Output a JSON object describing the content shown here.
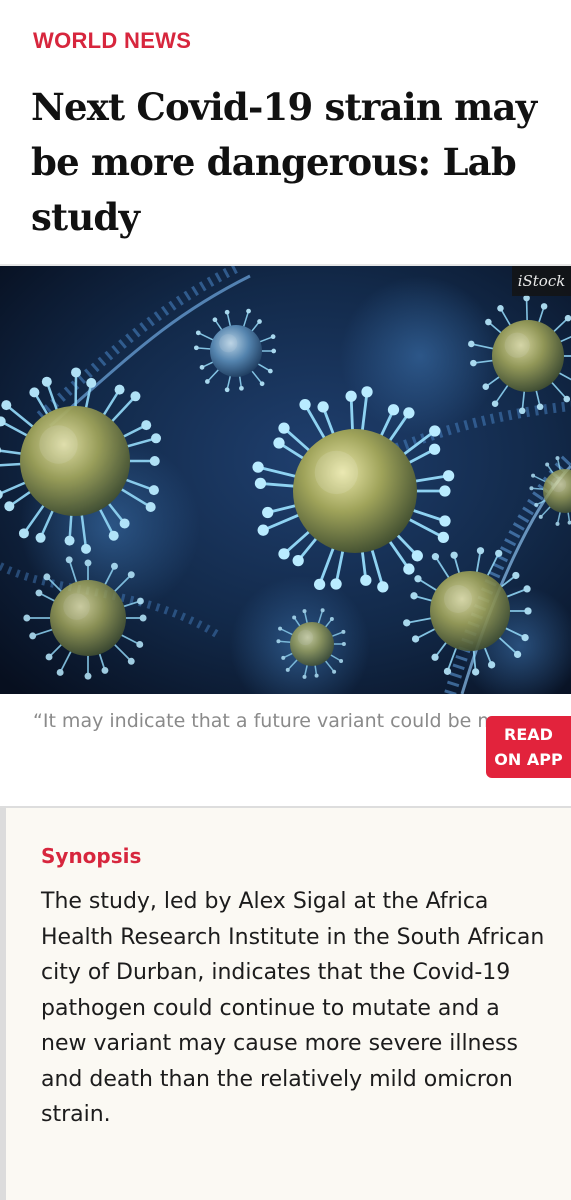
{
  "article": {
    "section": "WORLD NEWS",
    "headline": "Next Covid-19 strain may be more dangerous: Lab study",
    "image": {
      "credit": "iStock",
      "subject": "virus-illustration"
    },
    "caption": "“It may indicate that a future variant could be more pathogenic than currently circulating Omicron strains.”",
    "read_on_app": {
      "line1": "READ",
      "line2": "ON APP"
    }
  },
  "synopsis": {
    "title": "Synopsis",
    "text": "The study, led by Alex Sigal at the Africa Health Research Institute in the South African city of Durban, indicates that the Covid-19 pathogen could continue to mutate and a new variant may cause more severe illness and death than the relatively mild omicron strain."
  },
  "colors": {
    "accent": "#d7263d",
    "button": "#e2233c",
    "synopsis_bg": "#fbf9f3"
  }
}
